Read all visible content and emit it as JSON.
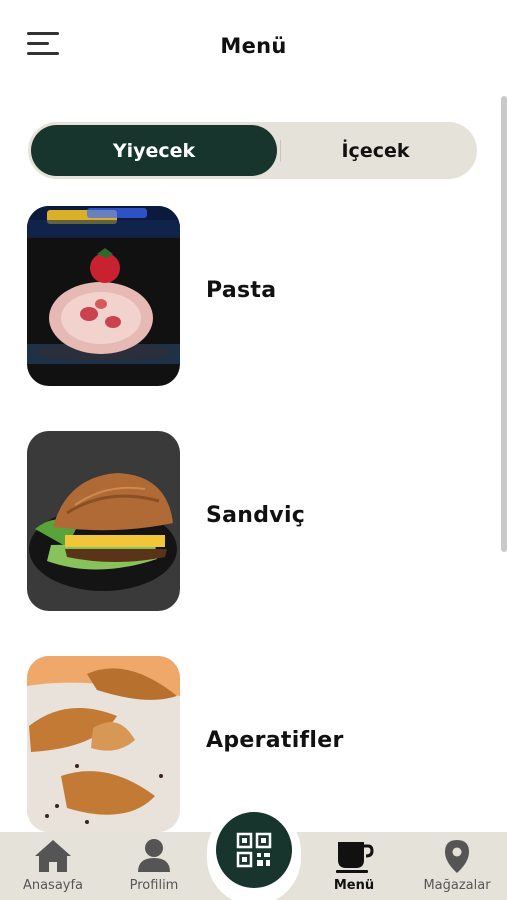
{
  "header": {
    "title": "Menü"
  },
  "segment": {
    "tabs": [
      {
        "label": "Yiyecek",
        "active": true
      },
      {
        "label": "İçecek",
        "active": false
      }
    ]
  },
  "categories": [
    {
      "label": "Pasta",
      "image": "strawberry-roll-cake-photo"
    },
    {
      "label": "Sandviç",
      "image": "croissant-sandwich-photo"
    },
    {
      "label": "Aperatifler",
      "image": "croissants-photo"
    }
  ],
  "bottom_nav": {
    "items": [
      {
        "label": "Anasayfa",
        "icon": "home-icon"
      },
      {
        "label": "Profilim",
        "icon": "user-icon"
      },
      {
        "label": "Menü",
        "icon": "coffee-cup-icon",
        "active": true
      },
      {
        "label": "Mağazalar",
        "icon": "map-pin-icon"
      }
    ],
    "center_button_icon": "qr-code-icon"
  },
  "colors": {
    "accent": "#17342d",
    "segment_bg": "#e5e3d9",
    "nav_bg": "#e5e3d9"
  }
}
